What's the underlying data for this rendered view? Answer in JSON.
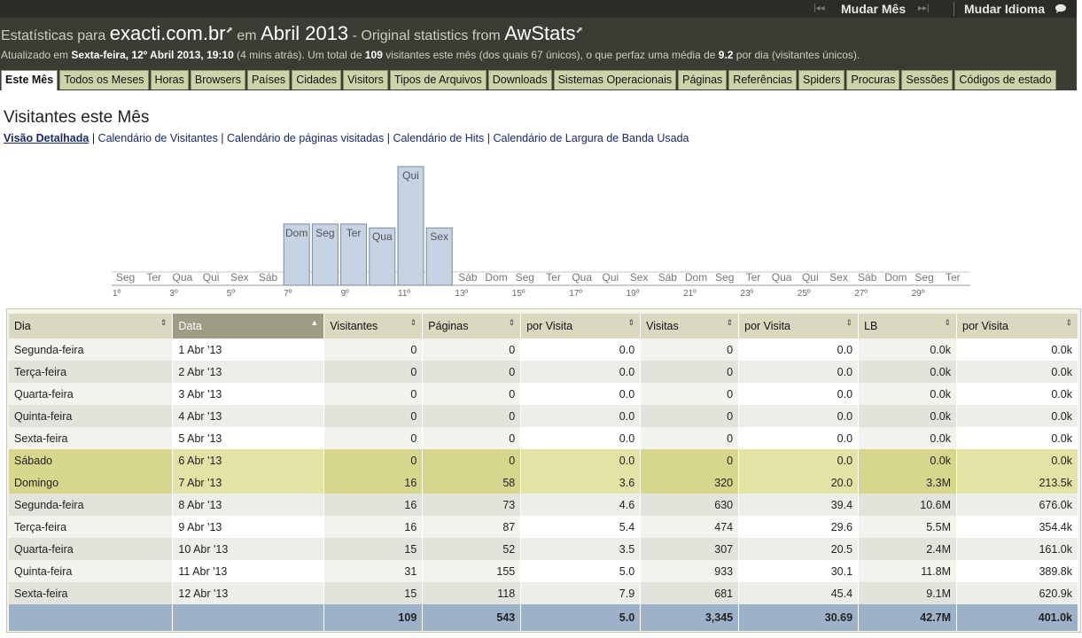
{
  "topbar": {
    "change_month_label": "Mudar Mês",
    "change_language_label": "Mudar Idioma",
    "first_icon": "|◂◂",
    "next_icon": "▸▸|",
    "chat_icon": "chat-bubble"
  },
  "title": {
    "prefix": "Estatísticas para",
    "site": "exacti.com.br",
    "connector": "em",
    "period": "Abril 2013",
    "dash": " - ",
    "original": "Original statistics from",
    "product": "AwStats"
  },
  "updated": {
    "label": "Atualizado em",
    "date": "Sexta-feira, 12º Abril 2013, 19:10",
    "ago": "(4 mins atrás).",
    "summary_a": "Um total de",
    "total": "109",
    "summary_b": "visitantes este mês (dos quais 67 únicos), o que perfaz uma média de",
    "avg": "9.2",
    "summary_c": "por dia (visitantes únicos)."
  },
  "tabs": [
    "Este Mês",
    "Todos os Meses",
    "Horas",
    "Browsers",
    "Países",
    "Cidades",
    "Visitors",
    "Tipos de Arquivos",
    "Downloads",
    "Sistemas Operacionais",
    "Páginas",
    "Referências",
    "Spiders",
    "Procuras",
    "Sessões",
    "Códigos de estado"
  ],
  "page_title": "Visitantes este Mês",
  "views": {
    "detailed": "Visão Detalhada",
    "sep": " | ",
    "cal_visitors": "Calendário de Visitantes",
    "cal_pages": "Calendário de páginas visitadas",
    "cal_hits": "Calendário de Hits",
    "cal_bandwidth": "Calendário de Largura de Banda Usada"
  },
  "chart_data": {
    "type": "bar",
    "categories": [
      "Seg",
      "Ter",
      "Qua",
      "Qui",
      "Sex",
      "Sáb",
      "Dom",
      "Seg",
      "Ter",
      "Qua",
      "Qui",
      "Sex",
      "Sáb",
      "Dom",
      "Seg",
      "Ter",
      "Qua",
      "Qui",
      "Sex",
      "Sáb",
      "Dom",
      "Seg",
      "Ter",
      "Qua",
      "Qui",
      "Sex",
      "Sáb",
      "Dom",
      "Seg",
      "Ter"
    ],
    "values": [
      0,
      0,
      0,
      0,
      0,
      0,
      16,
      16,
      16,
      15,
      31,
      15,
      0,
      0,
      0,
      0,
      0,
      0,
      0,
      0,
      0,
      0,
      0,
      0,
      0,
      0,
      0,
      0,
      0,
      0
    ],
    "day_labels": [
      "1º",
      "3º",
      "5º",
      "7º",
      "9º",
      "11º",
      "13º",
      "15º",
      "17º",
      "19º",
      "21º",
      "23º",
      "25º",
      "27º",
      "29º"
    ],
    "xlabel": "",
    "ylabel": "",
    "ylim": [
      0,
      31
    ],
    "bar_color": "#c5d3e4"
  },
  "table": {
    "headers": [
      "Dia",
      "Data",
      "Visitantes",
      "Páginas",
      "por Visita",
      "Visitas",
      "por Visita",
      "LB",
      "por Visita"
    ],
    "sort_icon": "⇕",
    "sort_active_icon": "▲",
    "rows": [
      {
        "day": "Segunda-feira",
        "date": "1 Abr '13",
        "visitors": "0",
        "pages": "0",
        "ppv": "0.0",
        "visits": "0",
        "vpv": "0.0",
        "bw": "0.0k",
        "bpv": "0.0k",
        "weekend": false
      },
      {
        "day": "Terça-feira",
        "date": "2 Abr '13",
        "visitors": "0",
        "pages": "0",
        "ppv": "0.0",
        "visits": "0",
        "vpv": "0.0",
        "bw": "0.0k",
        "bpv": "0.0k",
        "weekend": false
      },
      {
        "day": "Quarta-feira",
        "date": "3 Abr '13",
        "visitors": "0",
        "pages": "0",
        "ppv": "0.0",
        "visits": "0",
        "vpv": "0.0",
        "bw": "0.0k",
        "bpv": "0.0k",
        "weekend": false
      },
      {
        "day": "Quinta-feira",
        "date": "4 Abr '13",
        "visitors": "0",
        "pages": "0",
        "ppv": "0.0",
        "visits": "0",
        "vpv": "0.0",
        "bw": "0.0k",
        "bpv": "0.0k",
        "weekend": false
      },
      {
        "day": "Sexta-feira",
        "date": "5 Abr '13",
        "visitors": "0",
        "pages": "0",
        "ppv": "0.0",
        "visits": "0",
        "vpv": "0.0",
        "bw": "0.0k",
        "bpv": "0.0k",
        "weekend": false
      },
      {
        "day": "Sábado",
        "date": "6 Abr '13",
        "visitors": "0",
        "pages": "0",
        "ppv": "0.0",
        "visits": "0",
        "vpv": "0.0",
        "bw": "0.0k",
        "bpv": "0.0k",
        "weekend": true
      },
      {
        "day": "Domingo",
        "date": "7 Abr '13",
        "visitors": "16",
        "pages": "58",
        "ppv": "3.6",
        "visits": "320",
        "vpv": "20.0",
        "bw": "3.3M",
        "bpv": "213.5k",
        "weekend": true
      },
      {
        "day": "Segunda-feira",
        "date": "8 Abr '13",
        "visitors": "16",
        "pages": "73",
        "ppv": "4.6",
        "visits": "630",
        "vpv": "39.4",
        "bw": "10.6M",
        "bpv": "676.0k",
        "weekend": false
      },
      {
        "day": "Terça-feira",
        "date": "9 Abr '13",
        "visitors": "16",
        "pages": "87",
        "ppv": "5.4",
        "visits": "474",
        "vpv": "29.6",
        "bw": "5.5M",
        "bpv": "354.4k",
        "weekend": false
      },
      {
        "day": "Quarta-feira",
        "date": "10 Abr '13",
        "visitors": "15",
        "pages": "52",
        "ppv": "3.5",
        "visits": "307",
        "vpv": "20.5",
        "bw": "2.4M",
        "bpv": "161.0k",
        "weekend": false
      },
      {
        "day": "Quinta-feira",
        "date": "11 Abr '13",
        "visitors": "31",
        "pages": "155",
        "ppv": "5.0",
        "visits": "933",
        "vpv": "30.1",
        "bw": "11.8M",
        "bpv": "389.8k",
        "weekend": false
      },
      {
        "day": "Sexta-feira",
        "date": "12 Abr '13",
        "visitors": "15",
        "pages": "118",
        "ppv": "7.9",
        "visits": "681",
        "vpv": "45.4",
        "bw": "9.1M",
        "bpv": "620.9k",
        "weekend": false
      }
    ],
    "total": {
      "visitors": "109",
      "pages": "543",
      "ppv": "5.0",
      "visits": "3,345",
      "vpv": "30.69",
      "bw": "42.7M",
      "bpv": "401.0k"
    }
  },
  "colors": {
    "header_bg": "#3b3c34",
    "tab_bg": "#cdd2a9",
    "weekend_row": "#d6d78c",
    "total_row": "#9db1c9",
    "sorted_header": "#9c9d82"
  }
}
